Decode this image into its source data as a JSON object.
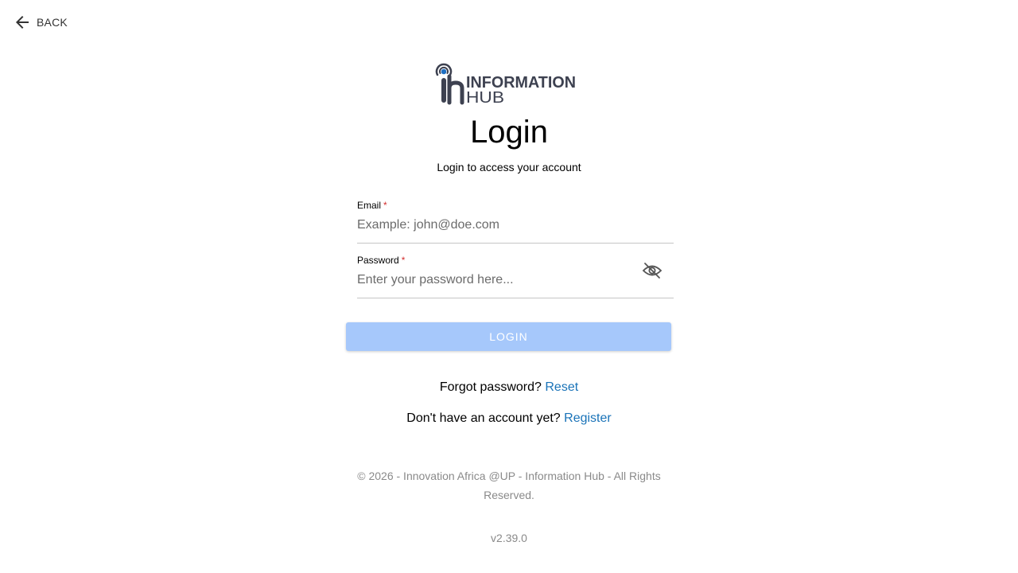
{
  "nav": {
    "back_label": "BACK",
    "back_icon": "arrow-left-icon"
  },
  "brand": {
    "logo_line1": "INFORMATION",
    "logo_line2": "HUB",
    "logo_mark": "ih",
    "colors": {
      "logo_dark": "#3d4150",
      "logo_accent": "#1e6fc2"
    }
  },
  "login": {
    "title": "Login",
    "subtitle": "Login to access your account",
    "email": {
      "label": "Email",
      "required_marker": "*",
      "value": "",
      "placeholder": "Example: john@doe.com"
    },
    "password": {
      "label": "Password",
      "required_marker": "*",
      "value": "",
      "placeholder": "Enter your password here...",
      "toggle_icon": "eye-off-icon"
    },
    "submit_label": "LOGIN",
    "submit_disabled": true,
    "forgot_text": "Forgot password?",
    "reset_link": "Reset",
    "register_text": "Don't have an account yet?",
    "register_link": "Register"
  },
  "footer": {
    "copyright": "© 2026 - Innovation Africa @UP - Information Hub - All Rights Reserved.",
    "version": "v2.39.0"
  },
  "colors": {
    "button_disabled": "#a6c8fb",
    "link": "#1a73b8",
    "required": "#d32f2f",
    "muted_text": "#8a8a8a"
  }
}
